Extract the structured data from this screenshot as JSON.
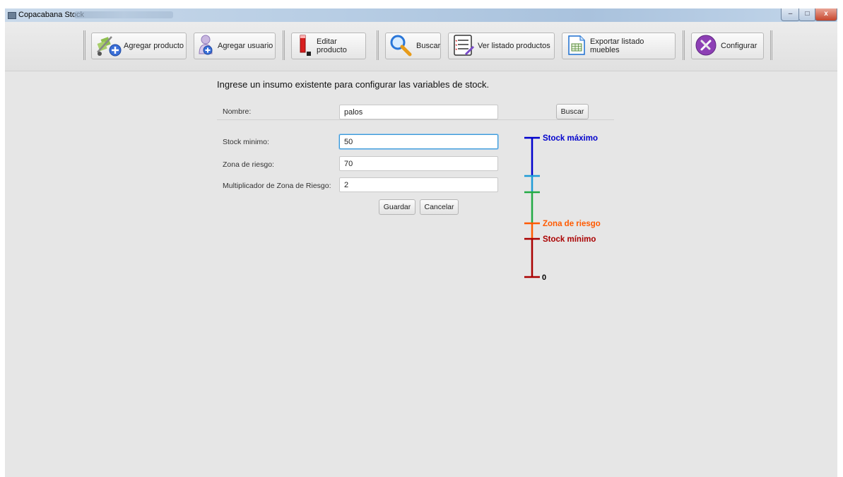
{
  "window": {
    "title": "Copacabana Stock",
    "controls": {
      "minimize": "–",
      "maximize": "□",
      "close": "x"
    }
  },
  "toolbar": {
    "buttons": [
      {
        "label": "Agregar producto",
        "icon": "hand-truck-add-icon"
      },
      {
        "label": "Agregar usuario",
        "icon": "user-add-icon"
      },
      {
        "label": "Editar producto",
        "icon": "pencil-icon"
      },
      {
        "label": "Buscar",
        "icon": "magnifier-icon"
      },
      {
        "label": "Ver listado productos",
        "icon": "checklist-icon"
      },
      {
        "label": "Exportar listado muebles",
        "icon": "spreadsheet-icon"
      },
      {
        "label": "Configurar",
        "icon": "tools-icon"
      }
    ]
  },
  "form": {
    "heading": "Ingrese un insumo existente para configurar las variables de stock.",
    "nombre_label": "Nombre:",
    "nombre_value": "palos",
    "buscar_label": "Buscar",
    "stock_minimo_label": "Stock minimo:",
    "stock_minimo_value": "50",
    "zona_riesgo_label": "Zona de riesgo:",
    "zona_riesgo_value": "70",
    "multiplicador_label": "Multiplicador de Zona de Riesgo:",
    "multiplicador_value": "2",
    "guardar_label": "Guardar",
    "cancelar_label": "Cancelar"
  },
  "gauge": {
    "max_label": "Stock máximo",
    "riesgo_label": "Zona de riesgo",
    "min_label": "Stock mínimo",
    "zero_label": "0",
    "colors": {
      "max": "#0000cc",
      "light_blue": "#1e9bd7",
      "green": "#22aa44",
      "orange": "#ff5a00",
      "red": "#aa0000"
    }
  }
}
